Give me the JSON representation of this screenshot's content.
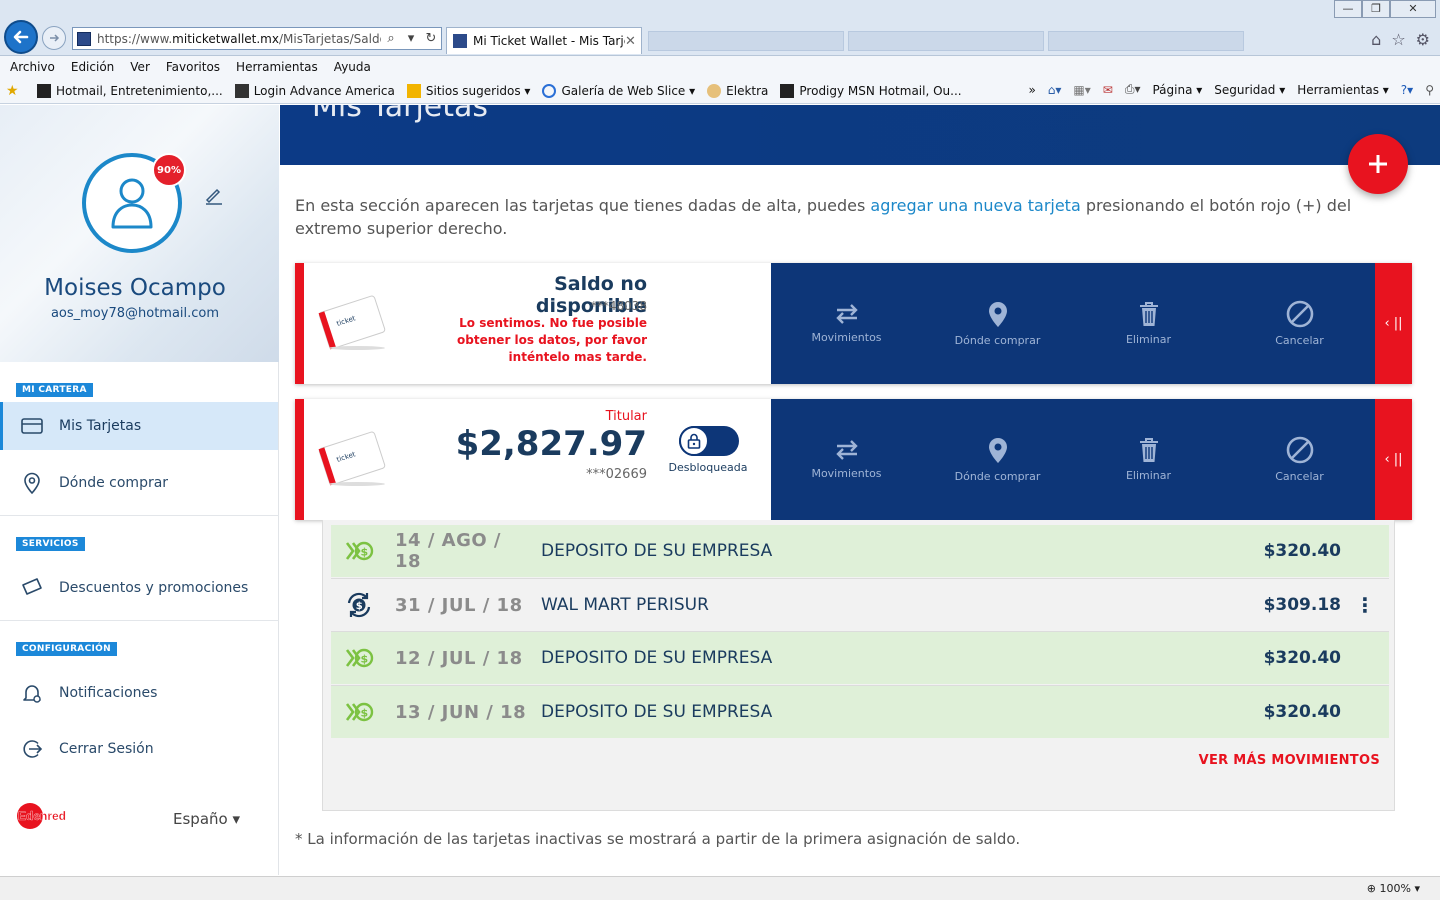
{
  "browser": {
    "url_prefix": "https://www.",
    "url_domain": "miticketwallet.mx",
    "url_path": "/MisTarjetas/Saldos",
    "tab_title": "Mi Ticket Wallet - Mis Tarje...",
    "menu": [
      "Archivo",
      "Edición",
      "Ver",
      "Favoritos",
      "Herramientas",
      "Ayuda"
    ],
    "favorites": [
      "Hotmail, Entretenimiento,...",
      "Login Advance America",
      "Sitios sugeridos ▾",
      "Galería de Web Slice ▾",
      "Elektra",
      "Prodigy MSN Hotmail, Ou..."
    ],
    "toolbar": {
      "page": "Página ▾",
      "security": "Seguridad ▾",
      "tools": "Herramientas ▾",
      "chevron": "»"
    },
    "zoom": "100%"
  },
  "sidebar": {
    "profile_progress": "90%",
    "user_name": "Moises Ocampo",
    "user_email": "aos_moy78@hotmail.com",
    "sections": {
      "wallet": "MI CARTERA",
      "services": "SERVICIOS",
      "config": "CONFIGURACIÓN"
    },
    "items": {
      "my_cards": "Mis Tarjetas",
      "where_buy": "Dónde comprar",
      "discounts": "Descuentos y promociones",
      "notifications": "Notificaciones",
      "logout": "Cerrar Sesión"
    },
    "brand": "Edenred",
    "language": "Españo ▾"
  },
  "main": {
    "page_title": "Mis Tarjetas",
    "intro_before": "En esta sección aparecen las tarjetas que tienes dadas de alta, puedes ",
    "intro_link": "agregar una nueva tarjeta",
    "intro_after": " presionando el botón rojo (+) del extremo superior derecho.",
    "actions": {
      "movements": "Movimientos",
      "where_buy": "Dónde comprar",
      "delete": "Eliminar",
      "cancel": "Cancelar",
      "side_toggle": "‹ ||"
    },
    "card1": {
      "title": "Saldo no disponible",
      "number": "***48038",
      "error": "Lo sentimos. No fue posible obtener los datos, por favor inténtelo mas tarde."
    },
    "card2": {
      "role": "Titular",
      "balance": "$2,827.97",
      "number": "***02669",
      "lock_status": "Desbloqueada"
    },
    "movements": [
      {
        "date": "14 / AGO / 18",
        "description": "DEPOSITO DE SU EMPRESA",
        "amount": "$320.40",
        "type": "deposit"
      },
      {
        "date": "31 / JUL / 18",
        "description": "WAL MART PERISUR",
        "amount": "$309.18",
        "type": "purchase"
      },
      {
        "date": "12 / JUL / 18",
        "description": "DEPOSITO DE SU EMPRESA",
        "amount": "$320.40",
        "type": "deposit"
      },
      {
        "date": "13 / JUN / 18",
        "description": "DEPOSITO DE SU EMPRESA",
        "amount": "$320.40",
        "type": "deposit"
      }
    ],
    "see_more": "VER MÁS MOVIMIENTOS",
    "footnote": "* La información de las tarjetas inactivas se mostrará a partir de la primera asignación de saldo."
  },
  "colors": {
    "brand_red": "#e8131f",
    "navy": "#0d3678",
    "accent_blue": "#1c88d9",
    "deposit_green": "#dff0d8",
    "icon_green": "#7cc242"
  }
}
